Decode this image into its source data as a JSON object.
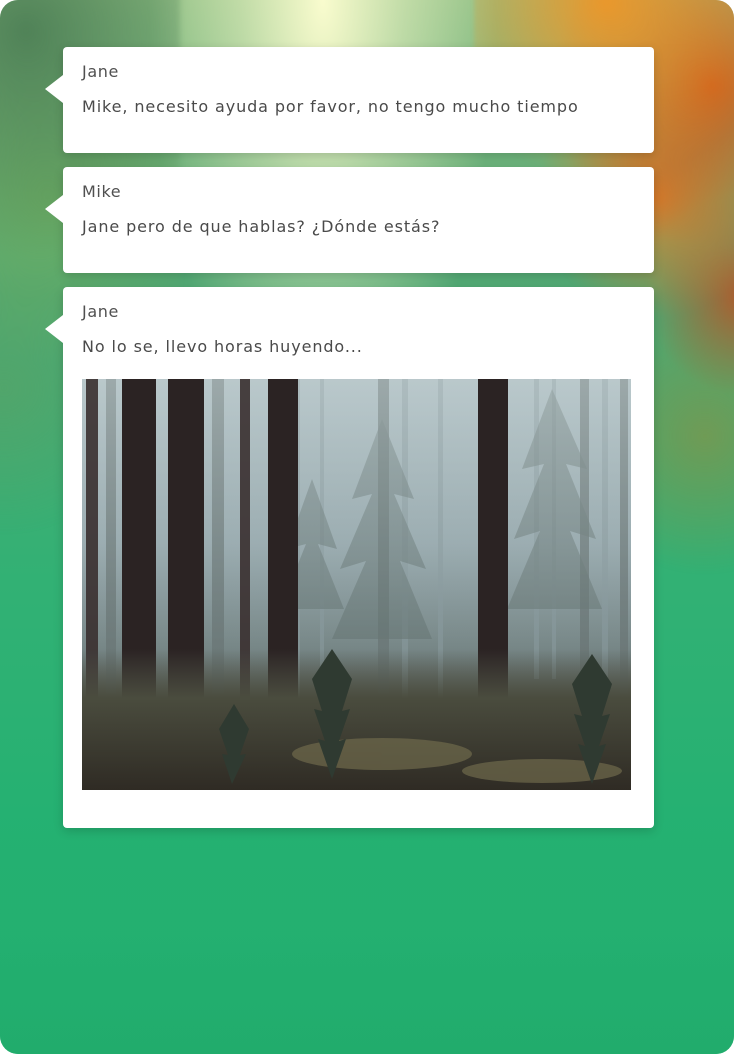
{
  "messages": [
    {
      "sender": "Jane",
      "text": "Mike, necesito ayuda por favor, no tengo mucho tiempo"
    },
    {
      "sender": "Mike",
      "text": "Jane pero de que hablas? ¿Dónde estás?"
    },
    {
      "sender": "Jane",
      "text": "No lo se, llevo horas huyendo...",
      "attachment": "forest-photo"
    }
  ],
  "colors": {
    "bubble": "#ffffff",
    "text": "#4a4a4a",
    "background_green": "#25b172",
    "background_orange": "#e07a25"
  }
}
